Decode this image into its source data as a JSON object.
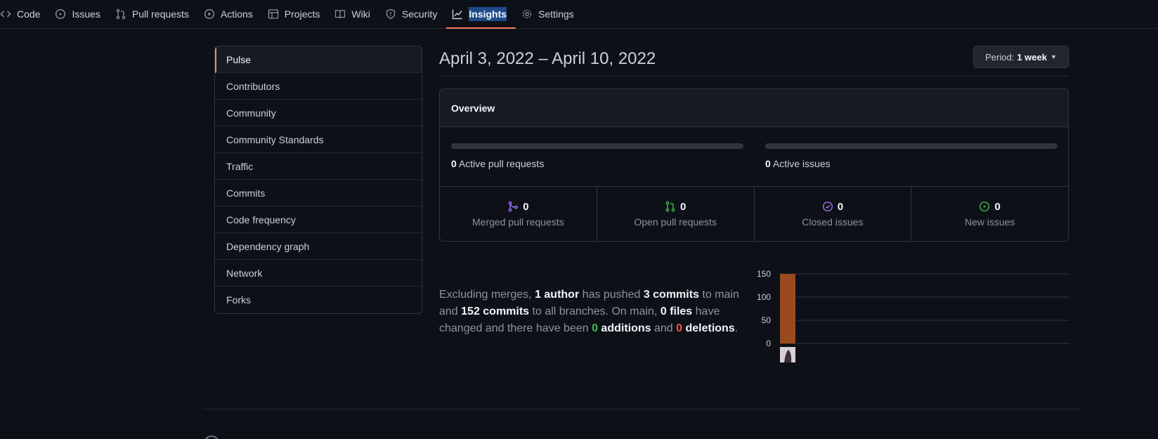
{
  "nav": {
    "tabs": [
      {
        "label": "Code",
        "icon": "code-icon"
      },
      {
        "label": "Issues",
        "icon": "issue-opened-icon"
      },
      {
        "label": "Pull requests",
        "icon": "git-pull-request-icon"
      },
      {
        "label": "Actions",
        "icon": "play-icon"
      },
      {
        "label": "Projects",
        "icon": "table-icon"
      },
      {
        "label": "Wiki",
        "icon": "book-icon"
      },
      {
        "label": "Security",
        "icon": "shield-icon"
      },
      {
        "label": "Insights",
        "icon": "graph-icon",
        "selected": true
      },
      {
        "label": "Settings",
        "icon": "gear-icon"
      }
    ]
  },
  "sidebar": {
    "items": [
      {
        "label": "Pulse",
        "active": true
      },
      {
        "label": "Contributors"
      },
      {
        "label": "Community"
      },
      {
        "label": "Community Standards"
      },
      {
        "label": "Traffic"
      },
      {
        "label": "Commits"
      },
      {
        "label": "Code frequency"
      },
      {
        "label": "Dependency graph"
      },
      {
        "label": "Network"
      },
      {
        "label": "Forks"
      }
    ]
  },
  "header": {
    "date_range": "April 3, 2022 – April 10, 2022",
    "period_label": "Period:",
    "period_value": "1 week"
  },
  "overview": {
    "title": "Overview",
    "active_prs_count": "0",
    "active_prs_label": "Active pull requests",
    "active_issues_count": "0",
    "active_issues_label": "Active issues",
    "stats": [
      {
        "count": "0",
        "label": "Merged pull requests",
        "icon": "git-merge-icon",
        "color": "#a371f7"
      },
      {
        "count": "0",
        "label": "Open pull requests",
        "icon": "git-pull-request-icon",
        "color": "#3fb950"
      },
      {
        "count": "0",
        "label": "Closed issues",
        "icon": "issue-closed-icon",
        "color": "#a371f7"
      },
      {
        "count": "0",
        "label": "New issues",
        "icon": "issue-opened-icon",
        "color": "#3fb950"
      }
    ]
  },
  "summary": {
    "p1": "Excluding merges, ",
    "authors": "1 author",
    "p2": " has pushed ",
    "commits_main": "3 commits",
    "p3": " to main and ",
    "commits_all": "152 commits",
    "p4": " to all branches. On main, ",
    "files": "0 files",
    "p5": " have changed and there have been ",
    "additions_num": "0",
    "additions_word": " additions",
    "p6": " and ",
    "deletions_num": "0",
    "deletions_word": " deletions",
    "p7": "."
  },
  "chart_data": {
    "type": "bar",
    "categories": [
      "author"
    ],
    "values": [
      152
    ],
    "ylim": [
      0,
      150
    ],
    "yticks": [
      0,
      50,
      100,
      150
    ],
    "bar_color": "#9a4a1e",
    "grid": true
  }
}
